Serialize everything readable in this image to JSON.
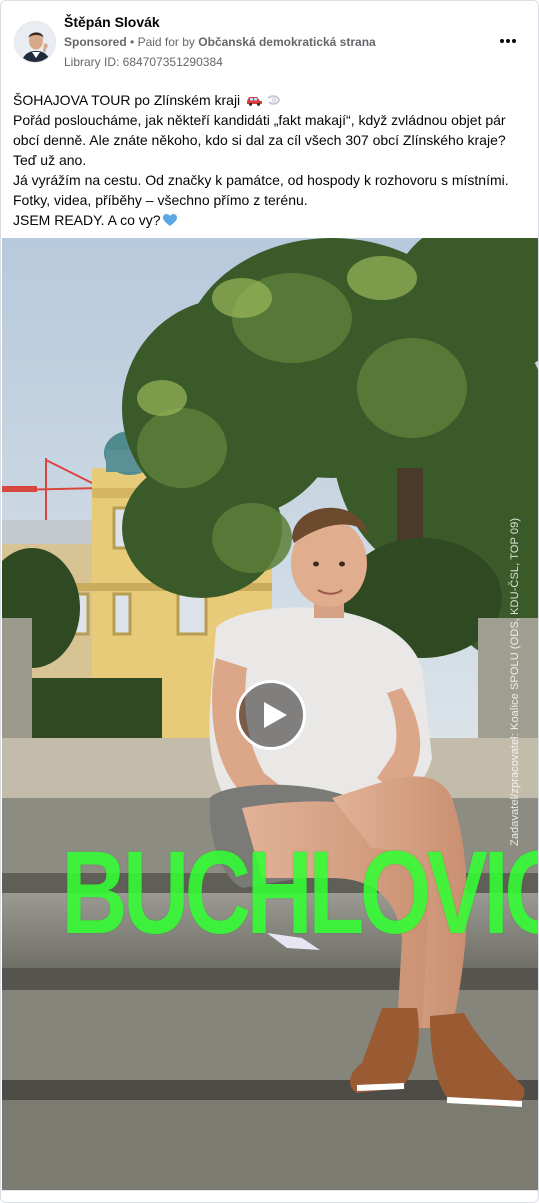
{
  "ad": {
    "author_name": "Štěpán Slovák",
    "sponsored_label": "Sponsored",
    "separator": "•",
    "paid_for_prefix": "Paid for by",
    "payer": "Občanská demokratická strana",
    "library_id": "Library ID: 684707351290384",
    "more_icon": "more-horizontal-icon"
  },
  "post": {
    "line1": "ŠOHAJOVA TOUR po Zlínském kraji",
    "line2": "Pořád posloucháme, jak někteří kandidáti „fakt makají“, když zvládnou objet pár obcí denně. Ale znáte někoho, kdo si dal za cíl všech 307 obcí Zlínského kraje? Teď už ano.",
    "line3": "Já vyrážím na cestu. Od značky k památce, od hospody k rozhovoru s místními.",
    "line4": "Fotky, videa, příběhy – všechno přímo z terénu.",
    "line5": "JSEM READY. A co vy?",
    "emoji_car": "car-emoji",
    "emoji_wind": "dash-emoji",
    "emoji_heart": "blue-heart-emoji"
  },
  "video": {
    "overlay_title": "BUCHLOVICE",
    "side_credit": "Zadavatel/zpracovatel: Koalice SPOLU (ODS, KDU-ČSL, TOP 09)",
    "play_icon": "play-icon",
    "colors": {
      "overlay_green": "#33ff33",
      "sky": "#c8d8e8",
      "building": "#e8c878",
      "foliage": "#3d5a2a",
      "stone": "#8a8a80",
      "shirt": "#e8e8e8",
      "shoes": "#9a5a32"
    }
  }
}
